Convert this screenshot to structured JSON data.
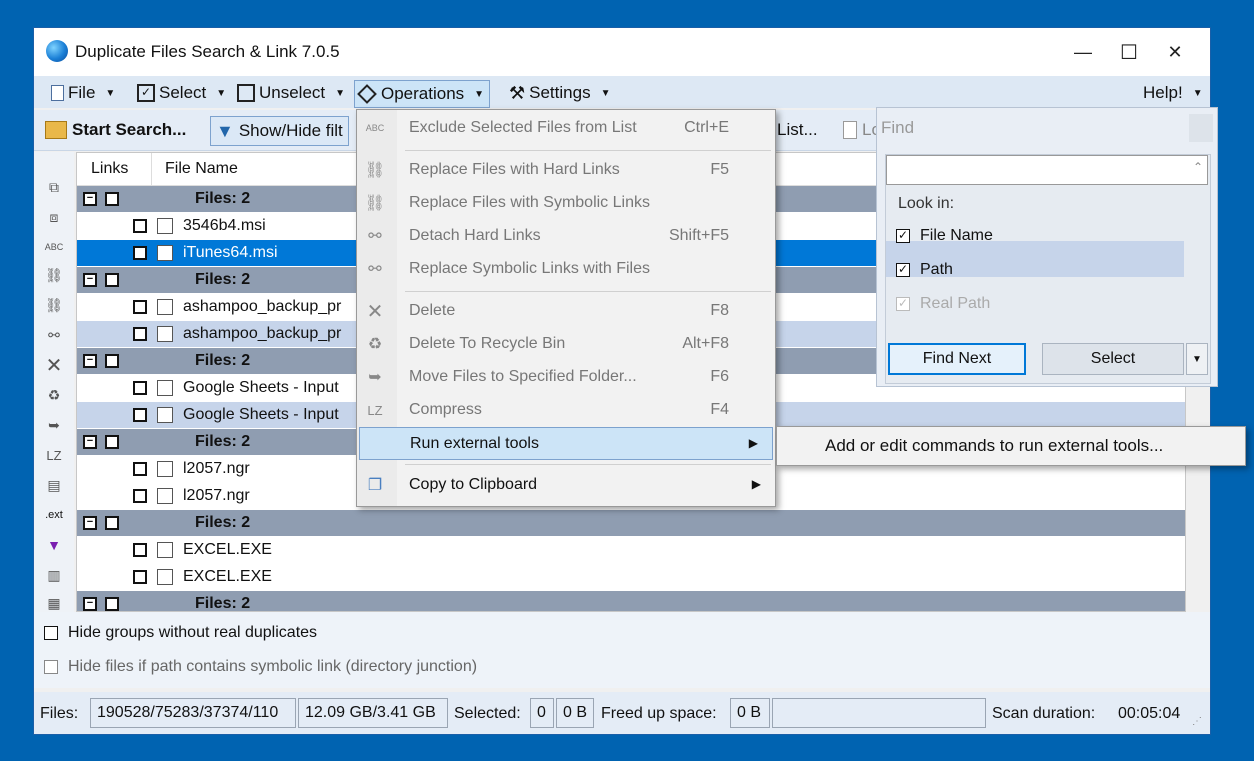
{
  "window": {
    "title": "Duplicate Files Search & Link 7.0.5",
    "minimize": "—",
    "maximize": "☐",
    "close": "✕"
  },
  "menubar": {
    "items": [
      {
        "label": "File",
        "icon": "file-icon"
      },
      {
        "label": "Select",
        "icon": "select-icon"
      },
      {
        "label": "Unselect",
        "icon": "unselect-icon"
      },
      {
        "label": "Operations",
        "icon": "operations-icon"
      },
      {
        "label": "Settings",
        "icon": "settings-icon"
      }
    ],
    "help": "Help!"
  },
  "toolbar": {
    "start_search": "Start Search...",
    "show_hide_filter": "Show/Hide filt",
    "list": "List...",
    "log": "Lo"
  },
  "grid": {
    "headers": [
      "Links",
      "File Name"
    ],
    "rows": [
      {
        "type": "group",
        "text": "Files: 2"
      },
      {
        "type": "file",
        "text": "3546b4.msi",
        "style": "normal"
      },
      {
        "type": "file",
        "text": "iTunes64.msi",
        "style": "selected"
      },
      {
        "type": "group",
        "text": "Files: 2"
      },
      {
        "type": "file",
        "text": "ashampoo_backup_pr",
        "style": "normal"
      },
      {
        "type": "file",
        "text": "ashampoo_backup_pr",
        "style": "alt"
      },
      {
        "type": "group",
        "text": "Files: 2"
      },
      {
        "type": "file",
        "text": "Google Sheets - Input",
        "style": "normal"
      },
      {
        "type": "file",
        "text": "Google Sheets - Input",
        "style": "alt"
      },
      {
        "type": "group",
        "text": "Files: 2"
      },
      {
        "type": "file",
        "text": "l2057.ngr",
        "style": "normal"
      },
      {
        "type": "file",
        "text": "l2057.ngr",
        "style": "normal"
      },
      {
        "type": "group",
        "text": "Files: 2"
      },
      {
        "type": "file",
        "text": "EXCEL.EXE",
        "style": "normal"
      },
      {
        "type": "file",
        "text": "EXCEL.EXE",
        "style": "normal"
      },
      {
        "type": "group",
        "text": "Files: 2"
      }
    ]
  },
  "options": {
    "hide_groups": "Hide groups without real duplicates",
    "hide_symlink": "Hide files if path contains symbolic link (directory junction)"
  },
  "status": {
    "files_label": "Files:",
    "files_value": "190528/75283/37374/110",
    "size_value": "12.09 GB/3.41 GB",
    "selected_label": "Selected:",
    "selected_count": "0",
    "selected_size": "0 B",
    "freed_label": "Freed up space:",
    "freed_value": "0 B",
    "scan_label": "Scan duration:",
    "scan_value": "00:05:04"
  },
  "operations_menu": {
    "items": [
      {
        "label": "Exclude Selected Files from List",
        "shortcut": "Ctrl+E"
      },
      {
        "label": "Replace Files with Hard Links",
        "shortcut": "F5"
      },
      {
        "label": "Replace Files with Symbolic Links",
        "shortcut": ""
      },
      {
        "label": "Detach Hard Links",
        "shortcut": "Shift+F5"
      },
      {
        "label": "Replace Symbolic Links with Files",
        "shortcut": ""
      },
      {
        "label": "Delete",
        "shortcut": "F8"
      },
      {
        "label": "Delete To Recycle Bin",
        "shortcut": "Alt+F8"
      },
      {
        "label": "Move Files to Specified Folder...",
        "shortcut": "F6"
      },
      {
        "label": "Compress",
        "shortcut": "F4"
      },
      {
        "label": "Run external tools",
        "shortcut": ""
      },
      {
        "label": "Copy to Clipboard",
        "shortcut": ""
      }
    ],
    "compress_icon_text": "LZ"
  },
  "submenu": {
    "item": "Add or edit commands to run external tools..."
  },
  "find_panel": {
    "title": "Find",
    "search_value": "",
    "look_in": "Look in:",
    "file_name": "File Name",
    "path": "Path",
    "real_path": "Real Path",
    "find_next": "Find Next",
    "select": "Select"
  },
  "left_strip": {
    "lz": "LZ",
    "ext": ".ext"
  },
  "colors": {
    "desktop": "#0063b1",
    "selection": "#0078d7",
    "group_row": "#8f9db1",
    "alt_row": "#c6d4ea",
    "menu_highlight": "#cce4f7"
  }
}
